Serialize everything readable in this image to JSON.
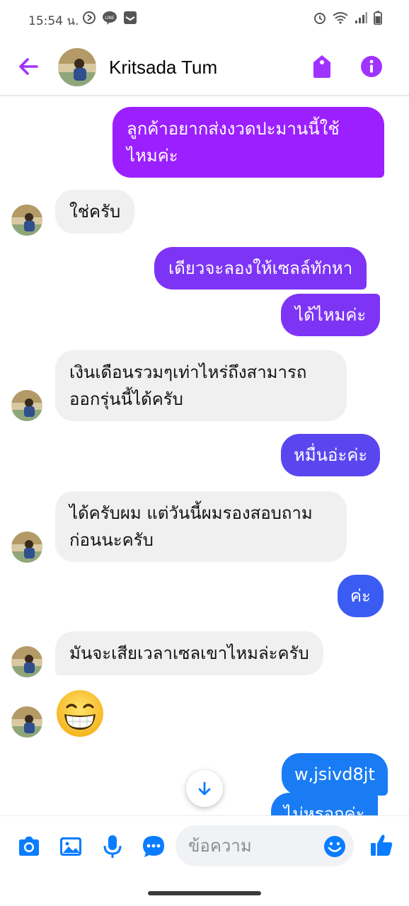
{
  "status_bar": {
    "time": "15:54 น."
  },
  "header": {
    "contact_name": "Kritsada Tum"
  },
  "messages": [
    {
      "dir": "out",
      "text": "ลูกค้าอยากส่งงวดปะมานนี้ใช้ไหมค่ะ"
    },
    {
      "dir": "in",
      "text": "ใช่ครับ"
    },
    {
      "dir": "out",
      "text": "เดียวจะลองให้เซลล์ทักหา"
    },
    {
      "dir": "out",
      "text": "ได้ไหมค่ะ"
    },
    {
      "dir": "in",
      "text": "เงินเดือนรวมๆเท่าไหร่ถึงสามารถออกรุ่นนี้ได้ครับ"
    },
    {
      "dir": "out",
      "text": "หมื่นอ่ะค่ะ"
    },
    {
      "dir": "in",
      "text": "ได้ครับผม แต่วันนี้ผมรองสอบถามก่อนนะครับ"
    },
    {
      "dir": "out",
      "text": "ค่ะ"
    },
    {
      "dir": "in",
      "text": "มันจะเสียเวลาเซลเขาไหมล่ะครับ"
    },
    {
      "dir": "in",
      "text": "😁",
      "emoji": "grinning-face-with-smiling-eyes"
    },
    {
      "dir": "out",
      "text": "w,jsivd8jt"
    },
    {
      "dir": "out",
      "text": "ไม่หรอกค่ะ"
    }
  ],
  "composer": {
    "placeholder": "ข้อความ"
  },
  "colors": {
    "accent": "#a033ff",
    "out_purple": "#9b1fff",
    "out_violet": "#7d34f5",
    "out_indigo": "#5a46ef",
    "out_blue": "#3a5cf2",
    "out_lightblue": "#1a7cf5",
    "incoming_bg": "#f0f0f0",
    "composer_icon": "#0a7cff"
  }
}
